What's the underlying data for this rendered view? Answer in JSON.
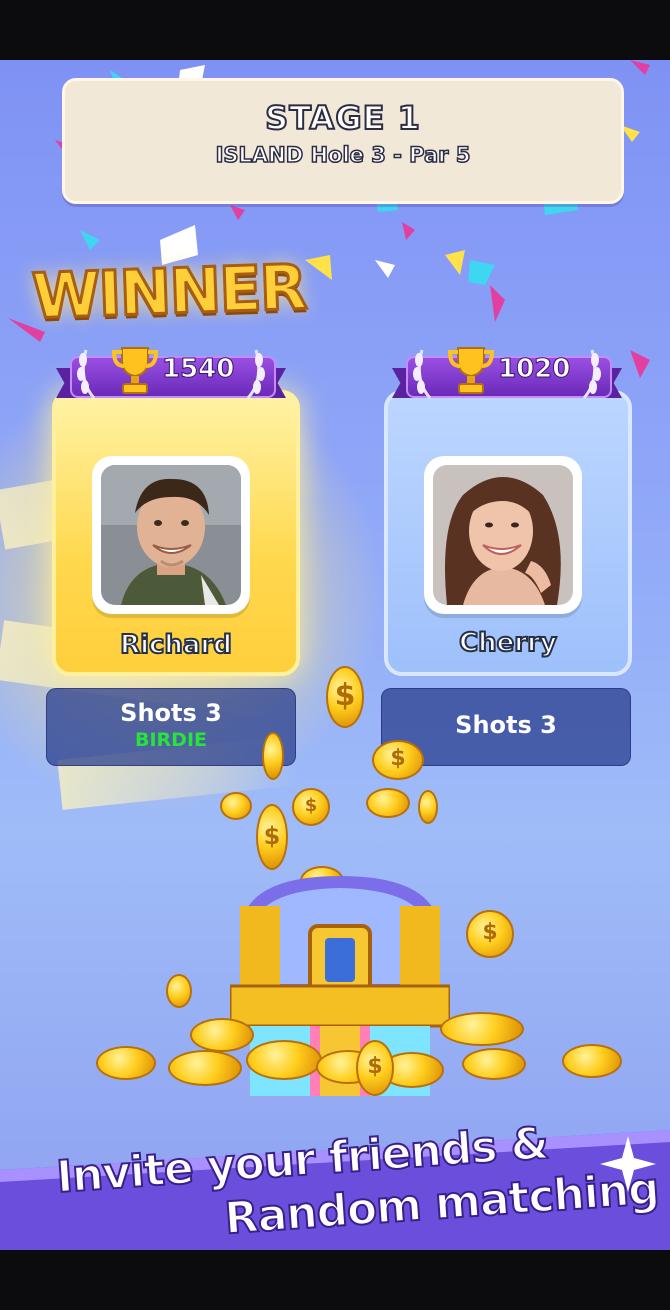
{
  "stage": {
    "title": "STAGE 1",
    "subtitle": "ISLAND Hole 3 - Par 5"
  },
  "winner_label": "WINNER",
  "players": [
    {
      "name": "Richard",
      "score": "1540",
      "shots": "Shots 3",
      "result": "BIRDIE",
      "winner": true
    },
    {
      "name": "Cherry",
      "score": "1020",
      "shots": "Shots 3",
      "result": "",
      "winner": false
    }
  ],
  "promo": {
    "line1": "Invite your friends &",
    "line2": "Random matching !"
  },
  "colors": {
    "background": "#8fa6f8",
    "winner_card": "#ffd84e",
    "loser_card": "#9ec0fb",
    "ribbon": "#7a38cc",
    "birdie": "#27e33a",
    "promo_band": "#6b4fdc"
  },
  "icons": [
    "trophy-icon",
    "laurel-icon",
    "coin-icon",
    "treasure-chest-icon",
    "sparkle-icon"
  ]
}
